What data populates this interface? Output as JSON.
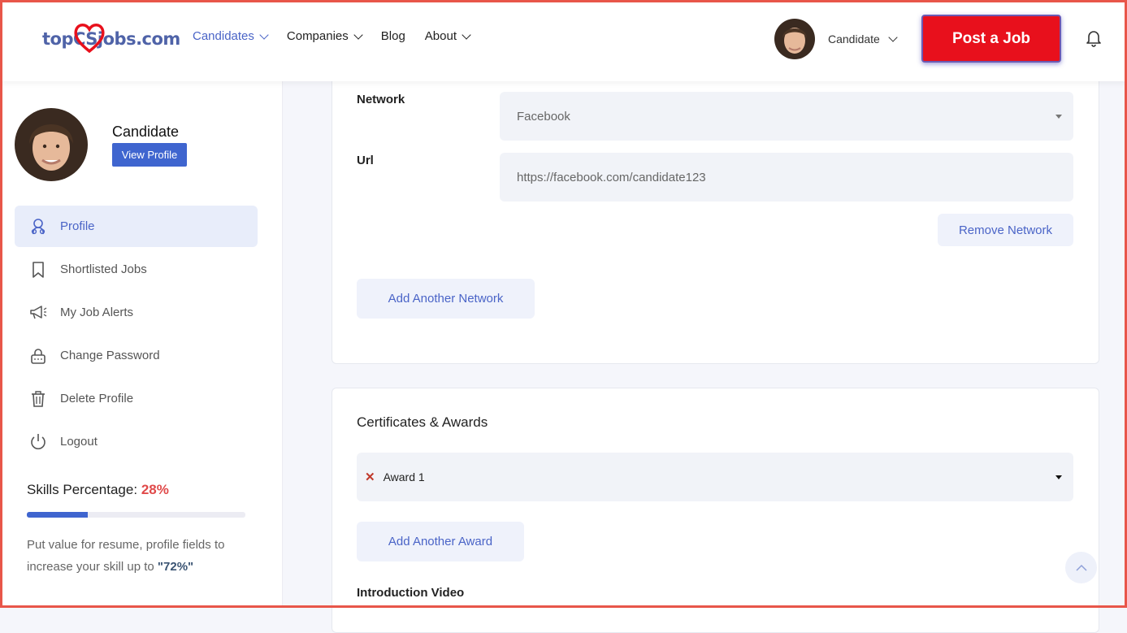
{
  "header": {
    "logo_text": "topCSjobs.com",
    "nav": [
      {
        "label": "Candidates",
        "has_dropdown": true,
        "active": true
      },
      {
        "label": "Companies",
        "has_dropdown": true,
        "active": false
      },
      {
        "label": "Blog",
        "has_dropdown": false,
        "active": false
      },
      {
        "label": "About",
        "has_dropdown": true,
        "active": false
      }
    ],
    "user_label": "Candidate",
    "post_job_label": "Post a Job",
    "colors": {
      "accent": "#4a64c7",
      "post_job": "#e8101c"
    }
  },
  "sidebar": {
    "name": "Candidate",
    "view_profile_label": "View Profile",
    "menu": [
      {
        "label": "Profile",
        "icon": "profile-icon",
        "active": true
      },
      {
        "label": "Shortlisted Jobs",
        "icon": "bookmark-icon",
        "active": false
      },
      {
        "label": "My Job Alerts",
        "icon": "megaphone-icon",
        "active": false
      },
      {
        "label": "Change Password",
        "icon": "lock-icon",
        "active": false
      },
      {
        "label": "Delete Profile",
        "icon": "trash-icon",
        "active": false
      },
      {
        "label": "Logout",
        "icon": "power-icon",
        "active": false
      }
    ],
    "skills": {
      "title": "Skills Percentage:",
      "percent_text": "28%",
      "percent_value": 28,
      "help_prefix": "Put value for resume, profile fields to increase your skill up to ",
      "help_target": "\"72%\""
    }
  },
  "network_form": {
    "network_label": "Network",
    "network_value": "Facebook",
    "url_label": "Url",
    "url_value": "https://facebook.com/candidate123",
    "remove_label": "Remove Network",
    "add_label": "Add Another Network"
  },
  "certificates": {
    "title": "Certificates & Awards",
    "selected_award": "Award 1",
    "add_label": "Add Another Award",
    "intro_video_label": "Introduction Video"
  }
}
